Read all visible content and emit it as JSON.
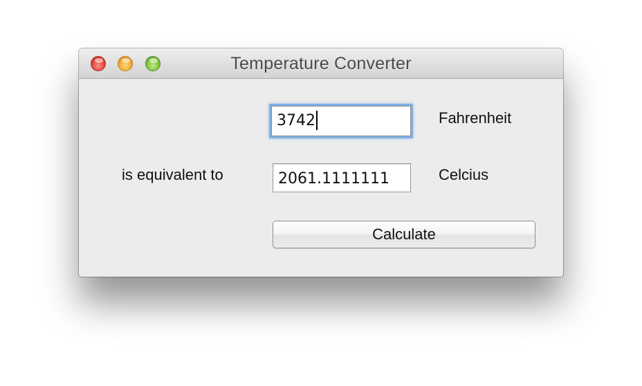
{
  "window": {
    "title": "Temperature Converter",
    "controls": [
      "close",
      "minimize",
      "zoom"
    ]
  },
  "form": {
    "fahrenheit_value": "3742",
    "fahrenheit_unit": "Fahrenheit",
    "equivalent_label": "is equivalent to",
    "celcius_value": "2061.1111111",
    "celcius_unit": "Celcius",
    "calculate_label": "Calculate"
  },
  "colors": {
    "close": "#e0443a",
    "minimize": "#f0a92b",
    "zoom": "#7dc43c",
    "focus_ring": "#7fb2e5"
  }
}
